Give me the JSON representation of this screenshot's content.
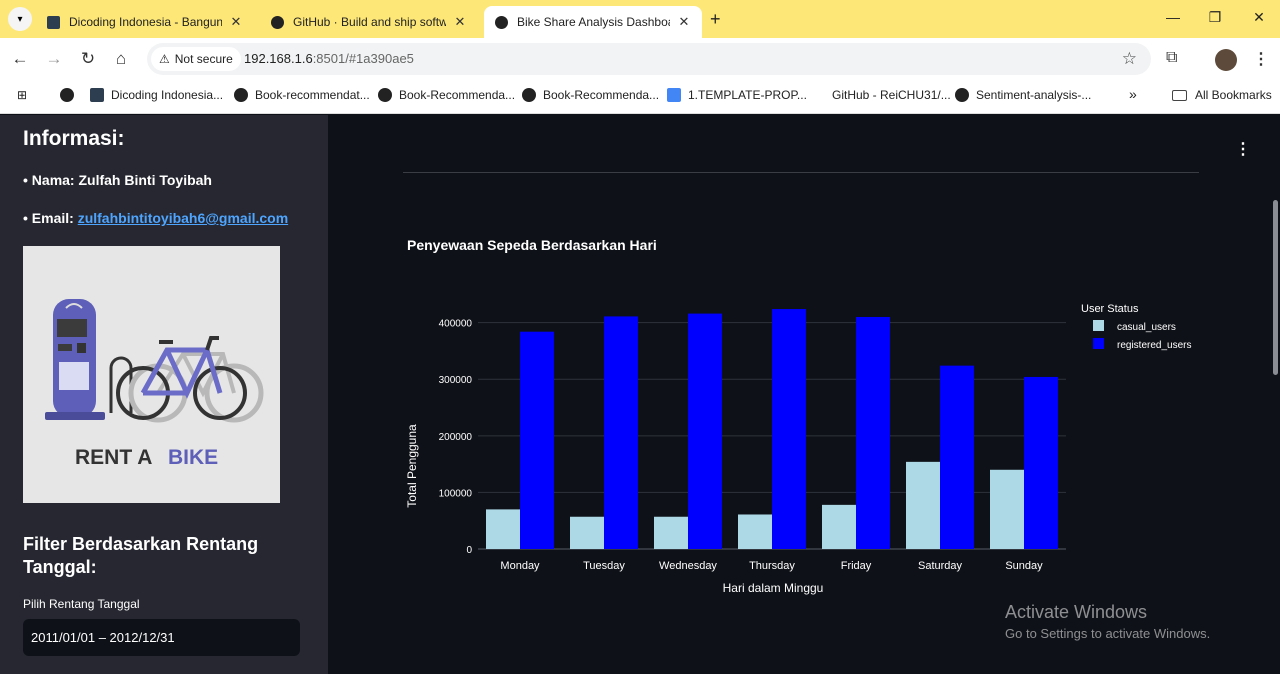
{
  "browser": {
    "tabs": [
      {
        "title": "Dicoding Indonesia - Bangun K",
        "icon": "dicoding-icon",
        "active": false
      },
      {
        "title": "GitHub · Build and ship softwa",
        "icon": "github-icon",
        "active": false
      },
      {
        "title": "Bike Share Analysis Dashboard",
        "icon": "streamlit-icon",
        "active": true
      }
    ],
    "security_label": "Not secure",
    "url_host": "192.168.1.6",
    "url_rest": ":8501/#1a390ae5",
    "bookmarks": [
      {
        "label": "Dicoding Indonesia...",
        "icon": "dicoding-icon"
      },
      {
        "label": "Book-recommendat...",
        "icon": "github-icon"
      },
      {
        "label": "Book-Recommenda...",
        "icon": "github-icon"
      },
      {
        "label": "Book-Recommenda...",
        "icon": "github-icon"
      },
      {
        "label": "1.TEMPLATE-PROP...",
        "icon": "doc-icon"
      },
      {
        "label": "GitHub - ReiCHU31/...",
        "icon": "none"
      },
      {
        "label": "Sentiment-analysis-...",
        "icon": "github-icon"
      }
    ],
    "all_bookmarks_label": "All Bookmarks"
  },
  "sidebar": {
    "title": "Informasi:",
    "name_line": "• Nama: Zulfah Binti Toyibah",
    "email_prefix": "• Email: ",
    "email": "zulfahbintitoyibah6@gmail.com",
    "image_text_1": "RENT A",
    "image_text_2": "BIKE",
    "filter_title": "Filter Berdasarkan Rentang Tanggal:",
    "date_label": "Pilih Rentang Tanggal",
    "date_value": "2011/01/01 – 2012/12/31"
  },
  "colors": {
    "casual": "#add8e6",
    "registered": "#0000ff",
    "background": "#0e1117",
    "sidebar": "#262730"
  },
  "chart_data": {
    "type": "bar",
    "title": "Penyewaan Sepeda Berdasarkan Hari",
    "xlabel": "Hari dalam Minggu",
    "ylabel": "Total Pengguna",
    "ylim": [
      0,
      440000
    ],
    "yticks": [
      0,
      100000,
      200000,
      300000,
      400000
    ],
    "categories": [
      "Monday",
      "Tuesday",
      "Wednesday",
      "Thursday",
      "Friday",
      "Saturday",
      "Sunday"
    ],
    "legend_title": "User Status",
    "legend_position": "top-right",
    "series": [
      {
        "name": "casual_users",
        "values": [
          70000,
          57000,
          57000,
          61000,
          78000,
          154000,
          140000
        ]
      },
      {
        "name": "registered_users",
        "values": [
          384000,
          411000,
          416000,
          424000,
          410000,
          324000,
          304000
        ]
      }
    ]
  },
  "watermark": {
    "line1": "Activate Windows",
    "line2": "Go to Settings to activate Windows."
  }
}
